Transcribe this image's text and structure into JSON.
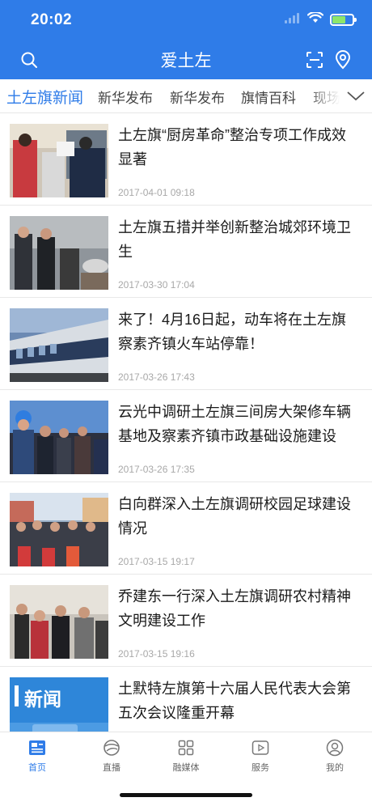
{
  "status_bar": {
    "time": "20:02"
  },
  "header": {
    "title": "爱土左"
  },
  "tabs": [
    {
      "label": "土左旗新闻",
      "active": true
    },
    {
      "label": "新华发布"
    },
    {
      "label": "新华发布"
    },
    {
      "label": "旗情百科"
    },
    {
      "label": "现场"
    }
  ],
  "news": [
    {
      "title": "土左旗“厨房革命”整治专项工作成效显著",
      "date": "2017-04-01 09:18"
    },
    {
      "title": "土左旗五措并举创新整治城郊环境卫生",
      "date": "2017-03-30 17:04"
    },
    {
      "title": "来了！4月16日起，动车将在土左旗察素齐镇火车站停靠！",
      "date": "2017-03-26 17:43"
    },
    {
      "title": "云光中调研土左旗三间房大架修车辆基地及察素齐镇市政基础设施建设",
      "date": "2017-03-26 17:35"
    },
    {
      "title": "白向群深入土左旗调研校园足球建设情况",
      "date": "2017-03-15 19:17"
    },
    {
      "title": "乔建东一行深入土左旗调研农村精神文明建设工作",
      "date": "2017-03-15 19:16"
    },
    {
      "title": "土默特左旗第十六届人民代表大会第五次会议隆重开幕",
      "date": ""
    }
  ],
  "thumb_7_text": "新闻",
  "bottom_nav": [
    {
      "label": "首页",
      "icon": "news-icon",
      "active": true
    },
    {
      "label": "直播",
      "icon": "live-icon"
    },
    {
      "label": "融媒体",
      "icon": "grid-icon"
    },
    {
      "label": "服务",
      "icon": "play-icon"
    },
    {
      "label": "我的",
      "icon": "profile-icon"
    }
  ],
  "colors": {
    "brand": "#2f7ce8",
    "date": "#a8a8a8",
    "battery": "#8ee66a"
  }
}
